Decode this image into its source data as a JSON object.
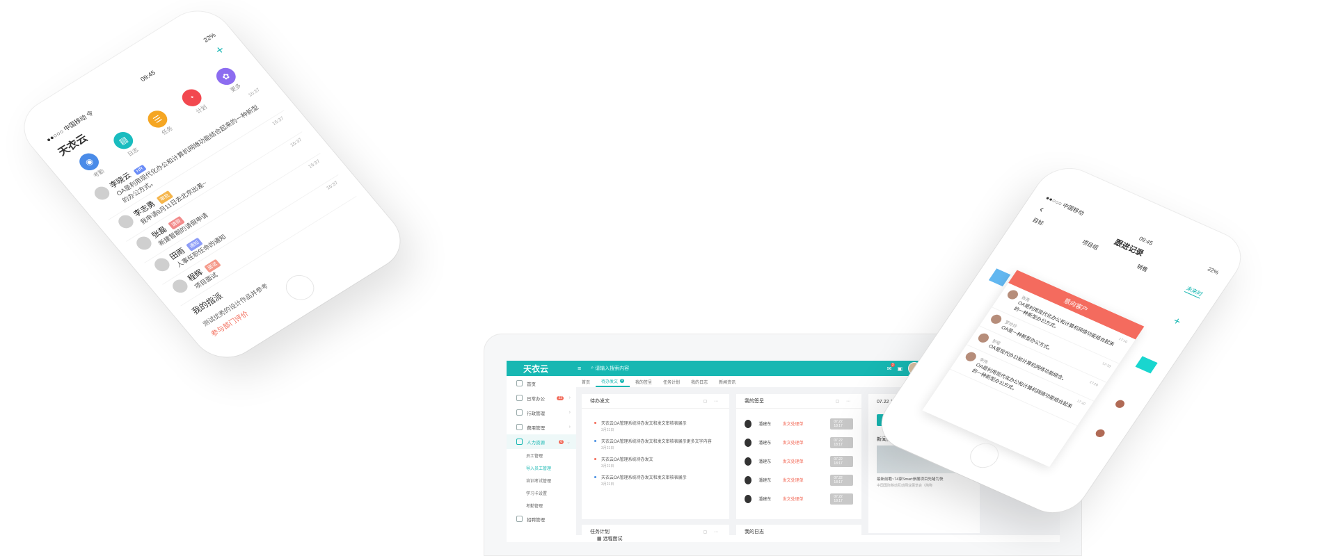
{
  "left_phone": {
    "carrier": "●●○○○ 中国移动 令",
    "time": "09:45",
    "battery": "22%",
    "app_title": "天衣云",
    "shortcuts": [
      {
        "label": "考勤",
        "color": "#4a8be8"
      },
      {
        "label": "日志",
        "color": "#19bcbf"
      },
      {
        "label": "任务",
        "color": "#f5a623"
      },
      {
        "label": "计划",
        "color": "#f2484f"
      },
      {
        "label": "更多",
        "color": "#8c6cf0"
      }
    ],
    "messages": [
      {
        "name": "李晓云",
        "tag": "HR",
        "tag_color": "#6a8cf7",
        "text": "OA是利用现代化办公和计算机网络功能结合起来的一种新型的办公方式。",
        "time": "16:37"
      },
      {
        "name": "李志勇",
        "tag": "审批",
        "tag_color": "#f5b64d",
        "text": "我申请9月11日去北京出差~",
        "time": "16:37"
      },
      {
        "name": "张磊",
        "tag": "请假",
        "tag_color": "#f28b8b",
        "text": "新建暂期的请假申请",
        "time": "16:37"
      },
      {
        "name": "田雨",
        "tag": "通知",
        "tag_color": "#8c9cf7",
        "text": "人事任职任命的通知",
        "time": "16:37"
      },
      {
        "name": "程辉",
        "tag": "面试",
        "tag_color": "#f59a8b",
        "text": "项目面试",
        "time": "16:37"
      }
    ],
    "section_title": "我的指派",
    "section_sub": "测试优秀的设计作品并参考",
    "section_link": "参与部门评价"
  },
  "desktop": {
    "brand": "天衣云",
    "menu_icon": "≡",
    "search_placeholder": "请输入搜索内容",
    "notify_count": "3",
    "sidebar": [
      {
        "label": "首页",
        "active": false
      },
      {
        "label": "日常办公",
        "badge": "33",
        "active": false
      },
      {
        "label": "行政管理",
        "active": false
      },
      {
        "label": "费用管理",
        "active": false
      },
      {
        "label": "人力资源",
        "badge": "6",
        "active": true
      }
    ],
    "sidebar_sub": [
      {
        "label": "员工管理",
        "active": false
      },
      {
        "label": "导入员工管理",
        "active": true
      },
      {
        "label": "培训考试管理",
        "active": false
      },
      {
        "label": "学习卡设置",
        "active": false
      },
      {
        "label": "考勤管理",
        "active": false
      }
    ],
    "sidebar_last": "招聘管理",
    "tabs": [
      {
        "label": "首页",
        "active": false
      },
      {
        "label": "待办发文",
        "active": true
      },
      {
        "label": "我的签呈",
        "active": false
      },
      {
        "label": "任务计划",
        "active": false
      },
      {
        "label": "我的日志",
        "active": false
      },
      {
        "label": "新闻资讯",
        "active": false
      }
    ],
    "todo_card": {
      "title": "待办发文",
      "items": [
        {
          "text": "天衣云OA管理系统待办发文和发文审核表展示",
          "date": "3月21日",
          "color": "#f36c5a"
        },
        {
          "text": "天衣云OA管理系统待办发文和发文审核表展示更多文字内容",
          "date": "3月21日",
          "color": "#4a90e2"
        },
        {
          "text": "天衣云OA管理系统待办发文",
          "date": "3月21日",
          "color": "#f36c5a"
        },
        {
          "text": "天衣云OA管理系统待办发文和发文审核表展示",
          "date": "3月21日",
          "color": "#4a90e2"
        }
      ]
    },
    "sign_card": {
      "title": "我的签呈",
      "rows": [
        {
          "name": "潘建东",
          "status": "发文处理单",
          "time": "07.22 18:17"
        },
        {
          "name": "潘建东",
          "status": "发文处理单",
          "time": "07.22 18:17"
        },
        {
          "name": "潘建东",
          "status": "发文处理单",
          "time": "07.22 18:17"
        },
        {
          "name": "潘建东",
          "status": "发文处理单",
          "time": "07.22 18:17"
        },
        {
          "name": "潘建东",
          "status": "发文处理单",
          "time": "07.22 18:17"
        }
      ]
    },
    "log_card": {
      "date": "07.22  18:17",
      "button": "日志",
      "news_title": "新闻资讯",
      "news_caption": "最新前瞻~74家Smart参展项目先睹为快",
      "news_caption2": "中国国际移动互动网业展览会（简称"
    },
    "task_title": "任务计划",
    "diary_title": "我的日志",
    "bottom_text": "远程面试"
  },
  "right_phone": {
    "carrier": "●●○○○ 中国移动",
    "time": "09:45",
    "battery": "22%",
    "title": "跟进记录",
    "tabs": [
      {
        "label": "目标",
        "active": false
      },
      {
        "label": "项目组",
        "active": false
      },
      {
        "label": "销售",
        "active": false
      },
      {
        "label": "未来时",
        "active": true
      }
    ],
    "card_head": "意向客户",
    "items": [
      {
        "name": "张亮",
        "text": "OA是利用现代化办公和计算机网络功能结合起来的一种新型办公方式。",
        "time": "17:10"
      },
      {
        "name": "罗玲玲",
        "text": "OA是一种新型办公方式。",
        "time": "17:10"
      },
      {
        "name": "彭晗",
        "text": "OA是现代办公和计算机网络功能结合。",
        "time": "17:10"
      },
      {
        "name": "李伟",
        "text": "OA是利用现代化办公和计算机网络功能结合起来的一种新型办公方式。",
        "time": "17:10"
      }
    ]
  }
}
